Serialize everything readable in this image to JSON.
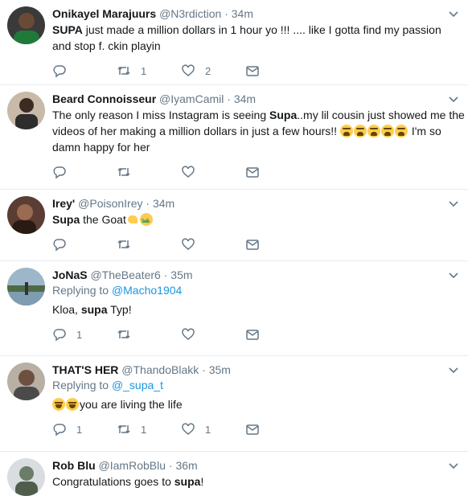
{
  "tweets": [
    {
      "name": "Onikayel Marajuurs",
      "handle": "@N3rdiction",
      "time": "34m",
      "text_bold": "SUPA",
      "text_rest": " just made a million dollars in 1 hour yo !!! .... like I gotta find my passion",
      "text_line2": "and stop f. ckin playin",
      "reply_count": "",
      "retweet_count": "1",
      "like_count": "2"
    },
    {
      "name": "Beard Connoisseur",
      "handle": "@IyamCamil",
      "time": "34m",
      "text_pre": "The only reason I miss Instagram is seeing ",
      "text_bold": "Supa",
      "text_rest": "..my lil cousin just showed me the",
      "text_line2": "videos of her making a million dollars in just a few hours!! ",
      "text_line2_end": " I'm so",
      "text_line3": "damn happy for her",
      "reply_count": "",
      "retweet_count": "",
      "like_count": ""
    },
    {
      "name": "Irey'",
      "handle": "@PoisonIrey",
      "time": "34m",
      "text_bold": "Supa",
      "text_rest": " the Goat",
      "reply_count": "",
      "retweet_count": "",
      "like_count": ""
    },
    {
      "name": "JoNaS",
      "handle": "@TheBeater6",
      "time": "35m",
      "replying_label": "Replying to ",
      "replying_to": "@Macho1904",
      "text_pre": "Kloa, ",
      "text_bold": "supa",
      "text_rest": " Typ!",
      "reply_count": "1",
      "retweet_count": "",
      "like_count": ""
    },
    {
      "name": "THAT'S HER",
      "handle": "@ThandoBlakk",
      "time": "35m",
      "replying_label": "Replying to ",
      "replying_to": "@_supa_t",
      "text_rest": "you are living the life",
      "reply_count": "1",
      "retweet_count": "1",
      "like_count": "1"
    },
    {
      "name": "Rob Blu",
      "handle": "@IamRobBlu",
      "time": "36m",
      "text_pre": "Congratulations goes to ",
      "text_bold": "supa",
      "text_rest": "!"
    }
  ],
  "separator": "·",
  "colors": {
    "name": "#14171a",
    "secondary": "#657786",
    "link": "#1b95e0",
    "divider": "#e6ecf0"
  },
  "icons": [
    "reply-icon",
    "retweet-icon",
    "like-icon",
    "direct-message-icon",
    "caret-down-icon"
  ]
}
